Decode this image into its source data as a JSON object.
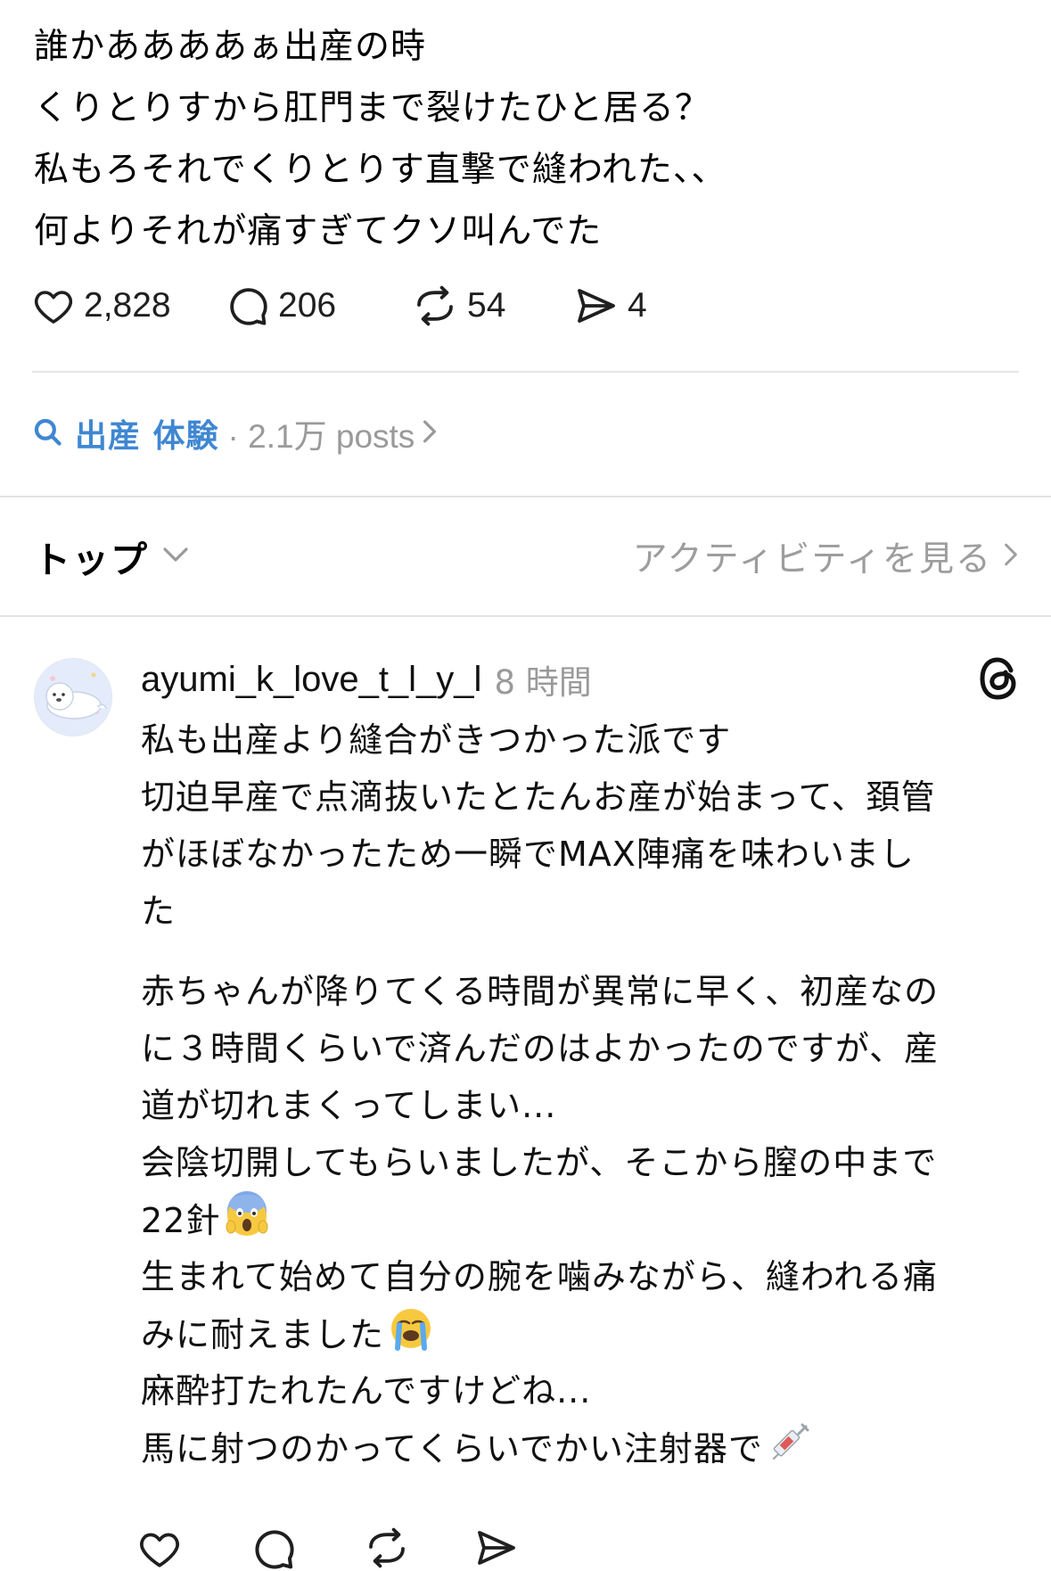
{
  "post": {
    "lines": [
      "誰かああああぁ出産の時",
      "くりとりすから肛門まで裂けたひと居る？",
      "私もろそれでくりとりす直撃で縫われた、、",
      "何よりそれが痛すぎてクソ叫んでた"
    ],
    "likes": "2,828",
    "replies": "206",
    "reposts": "54",
    "shares": "4"
  },
  "topic": {
    "label": "出産 体験",
    "meta": "· 2.1万 posts"
  },
  "sort": {
    "label": "トップ",
    "activity_link": "アクティビティを見る"
  },
  "reply": {
    "username": "ayumi_k_love_t_l_y_l",
    "time": "8 時間",
    "lines": [
      "私も出産より縫合がきつかった派です",
      "切迫早産で点滴抜いたとたんお産が始まって、頚管",
      "がほぼなかったため一瞬でMAX陣痛を味わいまし",
      "た"
    ],
    "lines2": [
      "赤ちゃんが降りてくる時間が異常に早く、初産なの",
      "に３時間くらいで済んだのはよかったのですが、産",
      "道が切れまくってしまい...",
      "会陰切開してもらいましたが、そこから膣の中まで"
    ],
    "line_22": "22針",
    "line_birth": "生まれて始めて自分の腕を噛みながら、縫われる痛",
    "line_endured": "みに耐えました",
    "line_anesthesia": "麻酔打たれたんですけどね...",
    "line_syringe": "馬に射つのかってくらいでかい注射器で"
  },
  "icons": {
    "like": "heart-icon",
    "reply": "speech-bubble-icon",
    "repost": "repost-icon",
    "share": "send-icon",
    "search": "search-icon",
    "threads": "threads-logo-icon"
  },
  "colors": {
    "topic_accent": "#3f87d2",
    "muted": "#9a9a9a",
    "divider": "#e6e6e6"
  }
}
